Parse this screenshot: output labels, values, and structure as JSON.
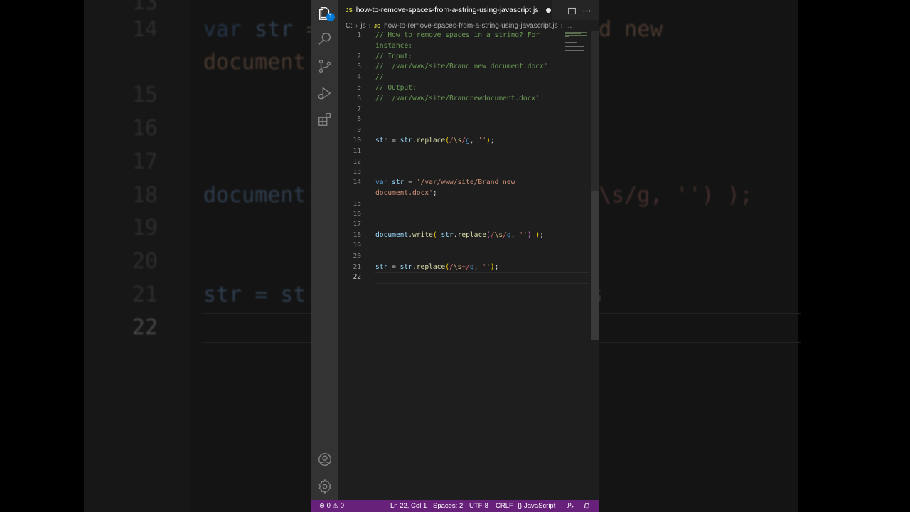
{
  "background": {
    "lines": [
      {
        "num": "14",
        "text": "var str = 'd new"
      },
      {
        "num": "",
        "text": "document"
      },
      {
        "num": "15",
        "text": ""
      },
      {
        "num": "16",
        "text": ""
      },
      {
        "num": "17",
        "text": ""
      },
      {
        "num": "18",
        "text": "document                     \\s/g, '') );"
      },
      {
        "num": "19",
        "text": ""
      },
      {
        "num": "20",
        "text": ""
      },
      {
        "num": "21",
        "text": "str = st                         s"
      },
      {
        "num": "22",
        "text": ""
      }
    ]
  },
  "activity_bar": {
    "icons": [
      "files-icon",
      "search-icon",
      "source-control-icon",
      "run-debug-icon",
      "extensions-icon",
      "account-icon",
      "settings-gear-icon"
    ],
    "explorer_badge": "1"
  },
  "tab": {
    "lang_badge": "JS",
    "filename": "how-to-remove-spaces-from-a-string-using-javascript.js",
    "modified": true
  },
  "breadcrumb": {
    "drive": "C:",
    "folder": "js",
    "lang_badge": "JS",
    "file": "how-to-remove-spaces-from-a-string-using-javascript.js",
    "more": "..."
  },
  "editor": {
    "line_numbers": [
      "1",
      "",
      "2",
      "3",
      "4",
      "5",
      "6",
      "7",
      "8",
      "9",
      "10",
      "11",
      "12",
      "13",
      "14",
      "",
      "15",
      "16",
      "17",
      "18",
      "19",
      "20",
      "21",
      "22"
    ],
    "active_line": "22",
    "lines": {
      "l1a": "// How to remove spaces in a string? For",
      "l1b": "instance:",
      "l2": "// Input:",
      "l3": "// '/var/www/site/Brand new document.docx'",
      "l4": "//",
      "l5": "// Output:",
      "l6": "// '/var/www/site/Brandnewdocument.docx'",
      "l14a_kw": "var",
      "l14a_var": "str",
      "l14a_str": "'/var/www/site/Brand new",
      "l14b_str": "document.docx'",
      "l18_obj": "document",
      "l18_fn": "write",
      "l18_var": "str",
      "l18_fn2": "replace",
      "l10_var": "str",
      "l10_var2": "str",
      "l10_fn": "replace",
      "l21_var": "str",
      "l21_var2": "str",
      "l21_fn": "replace"
    }
  },
  "status_bar": {
    "errors": "0",
    "warnings": "0",
    "position": "Ln 22, Col 1",
    "spaces": "Spaces: 2",
    "encoding": "UTF-8",
    "eol": "CRLF",
    "language": "JavaScript",
    "colors": {
      "background": "#68217a"
    }
  }
}
